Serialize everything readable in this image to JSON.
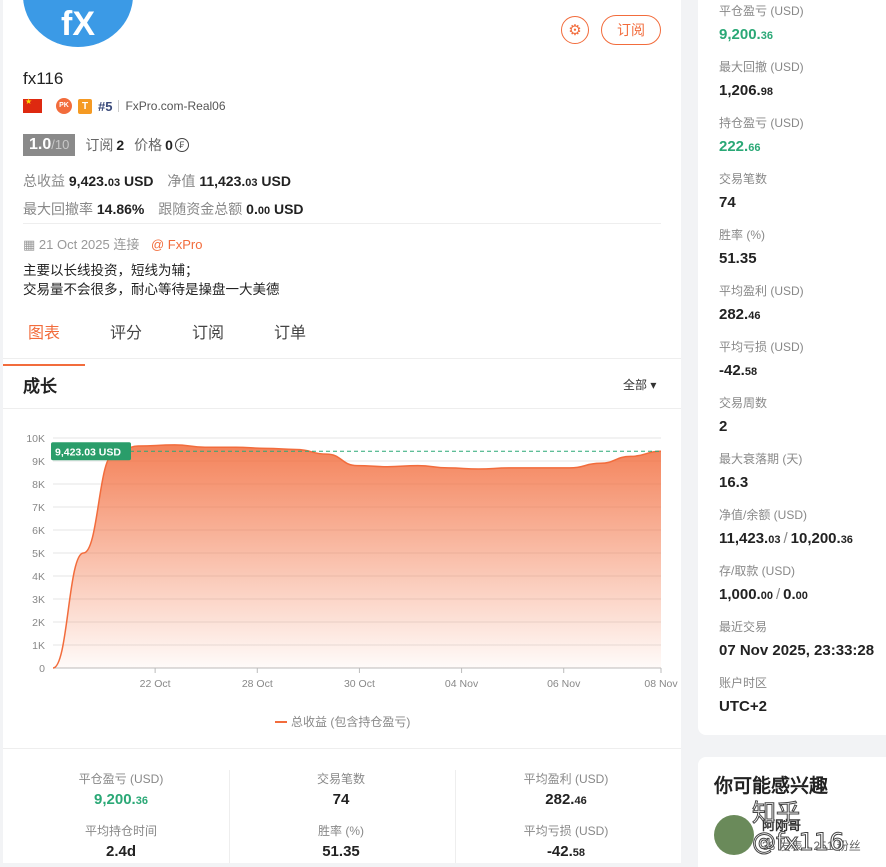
{
  "profile": {
    "avatar_text": "fX",
    "username": "fx116",
    "pk_badge": "PK",
    "t_badge": "T",
    "rank": "#5",
    "broker": "FxPro.com-Real06",
    "score": "1.0",
    "score_max": "/10",
    "subs_label": "订阅",
    "subs_value": "2",
    "price_label": "价格",
    "price_value": "0",
    "price_icon": "₣",
    "subscribe_button": "订阅",
    "settings_icon": "⚙",
    "total_profit_label": "总收益",
    "total_profit_int": "9,423.",
    "total_profit_dec": "03",
    "total_profit_unit": "USD",
    "equity_label": "净值",
    "equity_int": "11,423.",
    "equity_dec": "03",
    "equity_unit": "USD",
    "max_dd_label": "最大回撤率",
    "max_dd_value": "14.86%",
    "follow_funds_label": "跟随资金总额",
    "follow_funds_int": "0.",
    "follow_funds_dec": "00",
    "follow_funds_unit": "USD",
    "joined_icon": "▦",
    "joined": "21 Oct 2025 连接",
    "broker_link": "@ FxPro",
    "desc_line1": "主要以长线投资，短线为辅；",
    "desc_line2": "交易量不会很多，耐心等待是操盘一大美德"
  },
  "tabs": [
    "图表",
    "评分",
    "订阅",
    "订单"
  ],
  "chart_section": {
    "title": "成长",
    "range": "全部",
    "range_arrow": "▾",
    "legend": "总收益 (包含持仓盈亏)",
    "current_label": "9,423.03 USD"
  },
  "chart_data": {
    "type": "area",
    "y_ticks": [
      "0",
      "1K",
      "2K",
      "3K",
      "4K",
      "5K",
      "6K",
      "7K",
      "8K",
      "9K",
      "10K"
    ],
    "x_ticks": [
      "22 Oct",
      "28 Oct",
      "30 Oct",
      "04 Nov",
      "06 Nov",
      "08 Nov"
    ],
    "ylim": [
      0,
      10000
    ],
    "series": [
      {
        "name": "总收益 (包含持仓盈亏)",
        "x": [
          0,
          0.05,
          0.1,
          0.14,
          0.2,
          0.25,
          0.3,
          0.35,
          0.4,
          0.45,
          0.5,
          0.55,
          0.6,
          0.65,
          0.7,
          0.75,
          0.8,
          0.85,
          0.9,
          0.95,
          1.0
        ],
        "values": [
          0,
          5000,
          9300,
          9650,
          9700,
          9600,
          9600,
          9550,
          9500,
          9300,
          8800,
          8750,
          8800,
          8700,
          8650,
          8700,
          8700,
          8700,
          8900,
          9200,
          9423.03
        ]
      }
    ],
    "reference_line": 9423.03,
    "color": "#f26c3c"
  },
  "bottom_metrics": [
    {
      "label": "平仓盈亏 (USD)",
      "int": "9,200.",
      "dec": "36",
      "green": true
    },
    {
      "label": "交易笔数",
      "int": "74",
      "dec": "",
      "green": false
    },
    {
      "label": "平均盈利 (USD)",
      "int": "282.",
      "dec": "46",
      "green": false
    },
    {
      "label": "平均持仓时间",
      "int": "2.4d",
      "dec": "",
      "green": false
    },
    {
      "label": "胜率 (%)",
      "int": "51.35",
      "dec": "",
      "green": false
    },
    {
      "label": "平均亏损 (USD)",
      "int": "-42.",
      "dec": "58",
      "green": false
    }
  ],
  "side_stats": [
    {
      "label": "平仓盈亏 (USD)",
      "int": "9,200.",
      "dec": "36",
      "green": true
    },
    {
      "label": "最大回撤 (USD)",
      "int": "1,206.",
      "dec": "98"
    },
    {
      "label": "持仓盈亏 (USD)",
      "int": "222.",
      "dec": "66",
      "green": true
    },
    {
      "label": "交易笔数",
      "int": "74",
      "dec": ""
    },
    {
      "label": "胜率 (%)",
      "int": "51.35",
      "dec": ""
    },
    {
      "label": "平均盈利 (USD)",
      "int": "282.",
      "dec": "46"
    },
    {
      "label": "平均亏损 (USD)",
      "int": "-42.",
      "dec": "58"
    },
    {
      "label": "交易周数",
      "int": "2",
      "dec": ""
    },
    {
      "label": "最大衰落期 (天)",
      "int": "16.3",
      "dec": ""
    },
    {
      "label": "净值/余额 (USD)",
      "int": "11,423.",
      "dec": "03",
      "int2": "10,200.",
      "dec2": "36"
    },
    {
      "label": "存/取款 (USD)",
      "int": "1,000.",
      "dec": "00",
      "int2": "0.",
      "dec2": "00"
    },
    {
      "label": "最近交易",
      "int": "07 Nov 2025, 23:33:28",
      "dec": ""
    },
    {
      "label": "账户时区",
      "int": "UTC+2",
      "dec": ""
    }
  ],
  "interest": {
    "title": "你可能感兴趣",
    "rec_name": "阿刚哥",
    "rec_stats": "38 发表 · 251 粉丝",
    "watermark": "知乎 @fx116"
  }
}
